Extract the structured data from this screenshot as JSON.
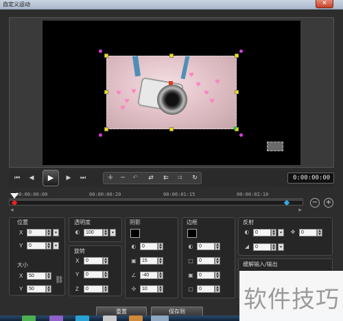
{
  "window": {
    "title": "自定义运动",
    "close_glyph": "✕"
  },
  "transport": {
    "timecode": "0:00:00:00",
    "icons": [
      "go-start-icon",
      "prev-frame-icon",
      "play-icon",
      "next-frame-icon",
      "go-end-icon"
    ],
    "play_glyph": "▶"
  },
  "timeline": {
    "ticks": [
      "00:00:00:00",
      "00:00:00:20",
      "00:00:01:15",
      "00:00:02:10"
    ]
  },
  "panels": {
    "position": {
      "title": "位置",
      "x_label": "X",
      "x": "0",
      "y_label": "Y",
      "y": "0"
    },
    "size": {
      "title": "大小",
      "x_label": "X",
      "x": "50",
      "y_label": "Y",
      "y": "50"
    },
    "opacity": {
      "title": "透明度",
      "value": "100"
    },
    "rotation": {
      "title": "旋转",
      "x_label": "X",
      "x": "0",
      "y_label": "Y",
      "y": "0",
      "z_label": "Z",
      "z": "0"
    },
    "shadow": {
      "title": "阴影",
      "v1": "0",
      "v2": "15",
      "v3": "-40",
      "v4": "10",
      "color": "#000000"
    },
    "border": {
      "title": "边框",
      "v1": "0",
      "v2": "0",
      "v3": "0",
      "v4": "0",
      "color": "#000000"
    },
    "reflection": {
      "title": "反射",
      "v1": "0",
      "v2": "0",
      "v3": "0"
    },
    "easing": {
      "title": "缓解输入/输出"
    }
  },
  "buttons": {
    "reset": "重置",
    "save_to": "保存到"
  },
  "watermark": {
    "text": "软件技巧"
  },
  "colors": {
    "handle_yellow": "#ffe000",
    "handle_magenta": "#d83cd8",
    "keyframe_start": "#e22222",
    "keyframe_end": "#3aa8e0"
  }
}
